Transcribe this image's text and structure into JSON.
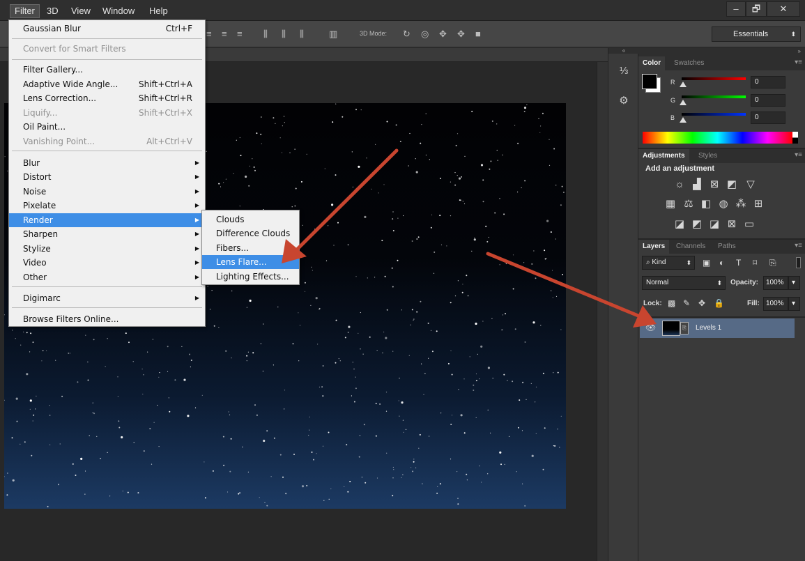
{
  "menubar": {
    "items": [
      "Filter",
      "3D",
      "View",
      "Window",
      "Help"
    ],
    "window_controls": [
      "–",
      "🗗",
      "✕"
    ]
  },
  "options": {
    "mode_label": "3D Mode:",
    "workspace": "Essentials"
  },
  "color_panel": {
    "tabs": [
      "Color",
      "Swatches"
    ],
    "channels": [
      {
        "label": "R",
        "value": "0",
        "color": "#e01010"
      },
      {
        "label": "G",
        "value": "0",
        "color": "#10c010"
      },
      {
        "label": "B",
        "value": "0",
        "color": "#1030ff"
      }
    ]
  },
  "adjust_panel": {
    "tabs": [
      "Adjustments",
      "Styles"
    ],
    "heading": "Add an adjustment"
  },
  "layers_panel": {
    "tabs": [
      "Layers",
      "Channels",
      "Paths"
    ],
    "filter_kind": "Kind",
    "blend_mode": "Normal",
    "opacity_label": "Opacity:",
    "opacity_value": "100%",
    "lock_label": "Lock:",
    "fill_label": "Fill:",
    "fill_value": "100%",
    "layer_name": "Levels 1"
  },
  "filter_menu": {
    "items": [
      {
        "label": "Gaussian Blur",
        "shortcut": "Ctrl+F"
      },
      {
        "label": "Convert for Smart Filters",
        "disabled": true
      },
      {
        "label": "Filter Gallery..."
      },
      {
        "label": "Adaptive Wide Angle...",
        "shortcut": "Shift+Ctrl+A"
      },
      {
        "label": "Lens Correction...",
        "shortcut": "Shift+Ctrl+R"
      },
      {
        "label": "Liquify...",
        "shortcut": "Shift+Ctrl+X",
        "disabled": true
      },
      {
        "label": "Oil Paint..."
      },
      {
        "label": "Vanishing Point...",
        "shortcut": "Alt+Ctrl+V",
        "disabled": true
      },
      {
        "label": "Blur",
        "submenu": true
      },
      {
        "label": "Distort",
        "submenu": true
      },
      {
        "label": "Noise",
        "submenu": true
      },
      {
        "label": "Pixelate",
        "submenu": true
      },
      {
        "label": "Render",
        "submenu": true,
        "highlighted": true
      },
      {
        "label": "Sharpen",
        "submenu": true
      },
      {
        "label": "Stylize",
        "submenu": true
      },
      {
        "label": "Video",
        "submenu": true
      },
      {
        "label": "Other",
        "submenu": true
      },
      {
        "label": "Digimarc",
        "submenu": true
      },
      {
        "label": "Browse Filters Online..."
      }
    ]
  },
  "render_submenu": {
    "items": [
      {
        "label": "Clouds"
      },
      {
        "label": "Difference Clouds"
      },
      {
        "label": "Fibers..."
      },
      {
        "label": "Lens Flare...",
        "highlighted": true
      },
      {
        "label": "Lighting Effects..."
      }
    ]
  },
  "colors": {
    "menu_highlight": "#3e8ee6",
    "annotation_arrow": "#c8452f",
    "layer_selected": "#566a86"
  }
}
